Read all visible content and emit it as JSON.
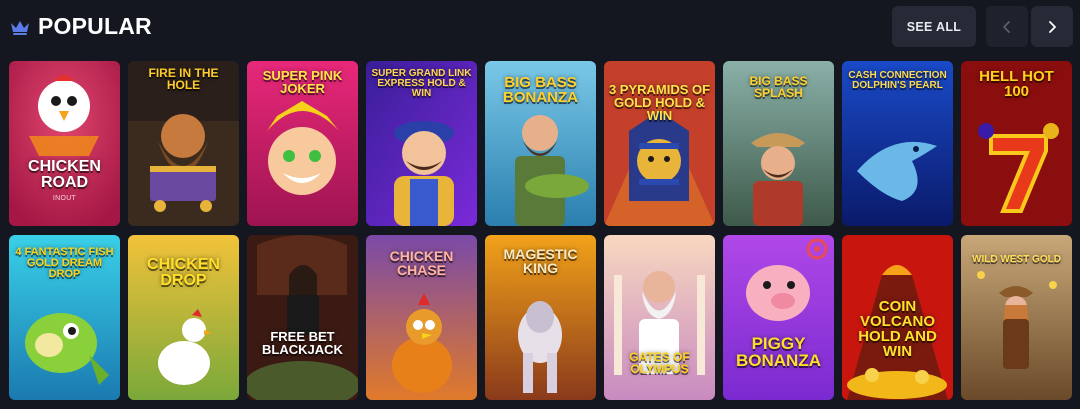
{
  "section": {
    "title": "POPULAR",
    "see_all_label": "SEE ALL",
    "icon": "crown-icon",
    "prev_icon": "chevron-left-icon",
    "next_icon": "chevron-right-icon"
  },
  "colors": {
    "background": "#141720",
    "button": "#262a36",
    "button_disabled": "#1f222c",
    "crown_accent": "#5b7ce8"
  },
  "games": [
    {
      "name": "CHICKEN ROAD",
      "provider": "INOUT"
    },
    {
      "name": "FIRE IN THE HOLE"
    },
    {
      "name": "SUPER PINK JOKER"
    },
    {
      "name": "SUPER GRAND LINK EXPRESS HOLD & WIN"
    },
    {
      "name": "BIG BASS BONANZA"
    },
    {
      "name": "3 PYRAMIDS OF GOLD HOLD & WIN"
    },
    {
      "name": "BIG BASS SPLASH"
    },
    {
      "name": "CASH CONNECTION DOLPHIN'S PEARL"
    },
    {
      "name": "HELL HOT 100"
    },
    {
      "name": "4 FANTASTIC FISH GOLD DREAM DROP"
    },
    {
      "name": "CHICKEN DROP"
    },
    {
      "name": "FREE BET BLACKJACK"
    },
    {
      "name": "CHICKEN CHASE"
    },
    {
      "name": "MAGESTIC KING"
    },
    {
      "name": "GATES OF OLYMPUS"
    },
    {
      "name": "PIGGY BONANZA"
    },
    {
      "name": "COIN VOLCANO HOLD AND WIN"
    },
    {
      "name": "WILD WEST GOLD"
    }
  ]
}
